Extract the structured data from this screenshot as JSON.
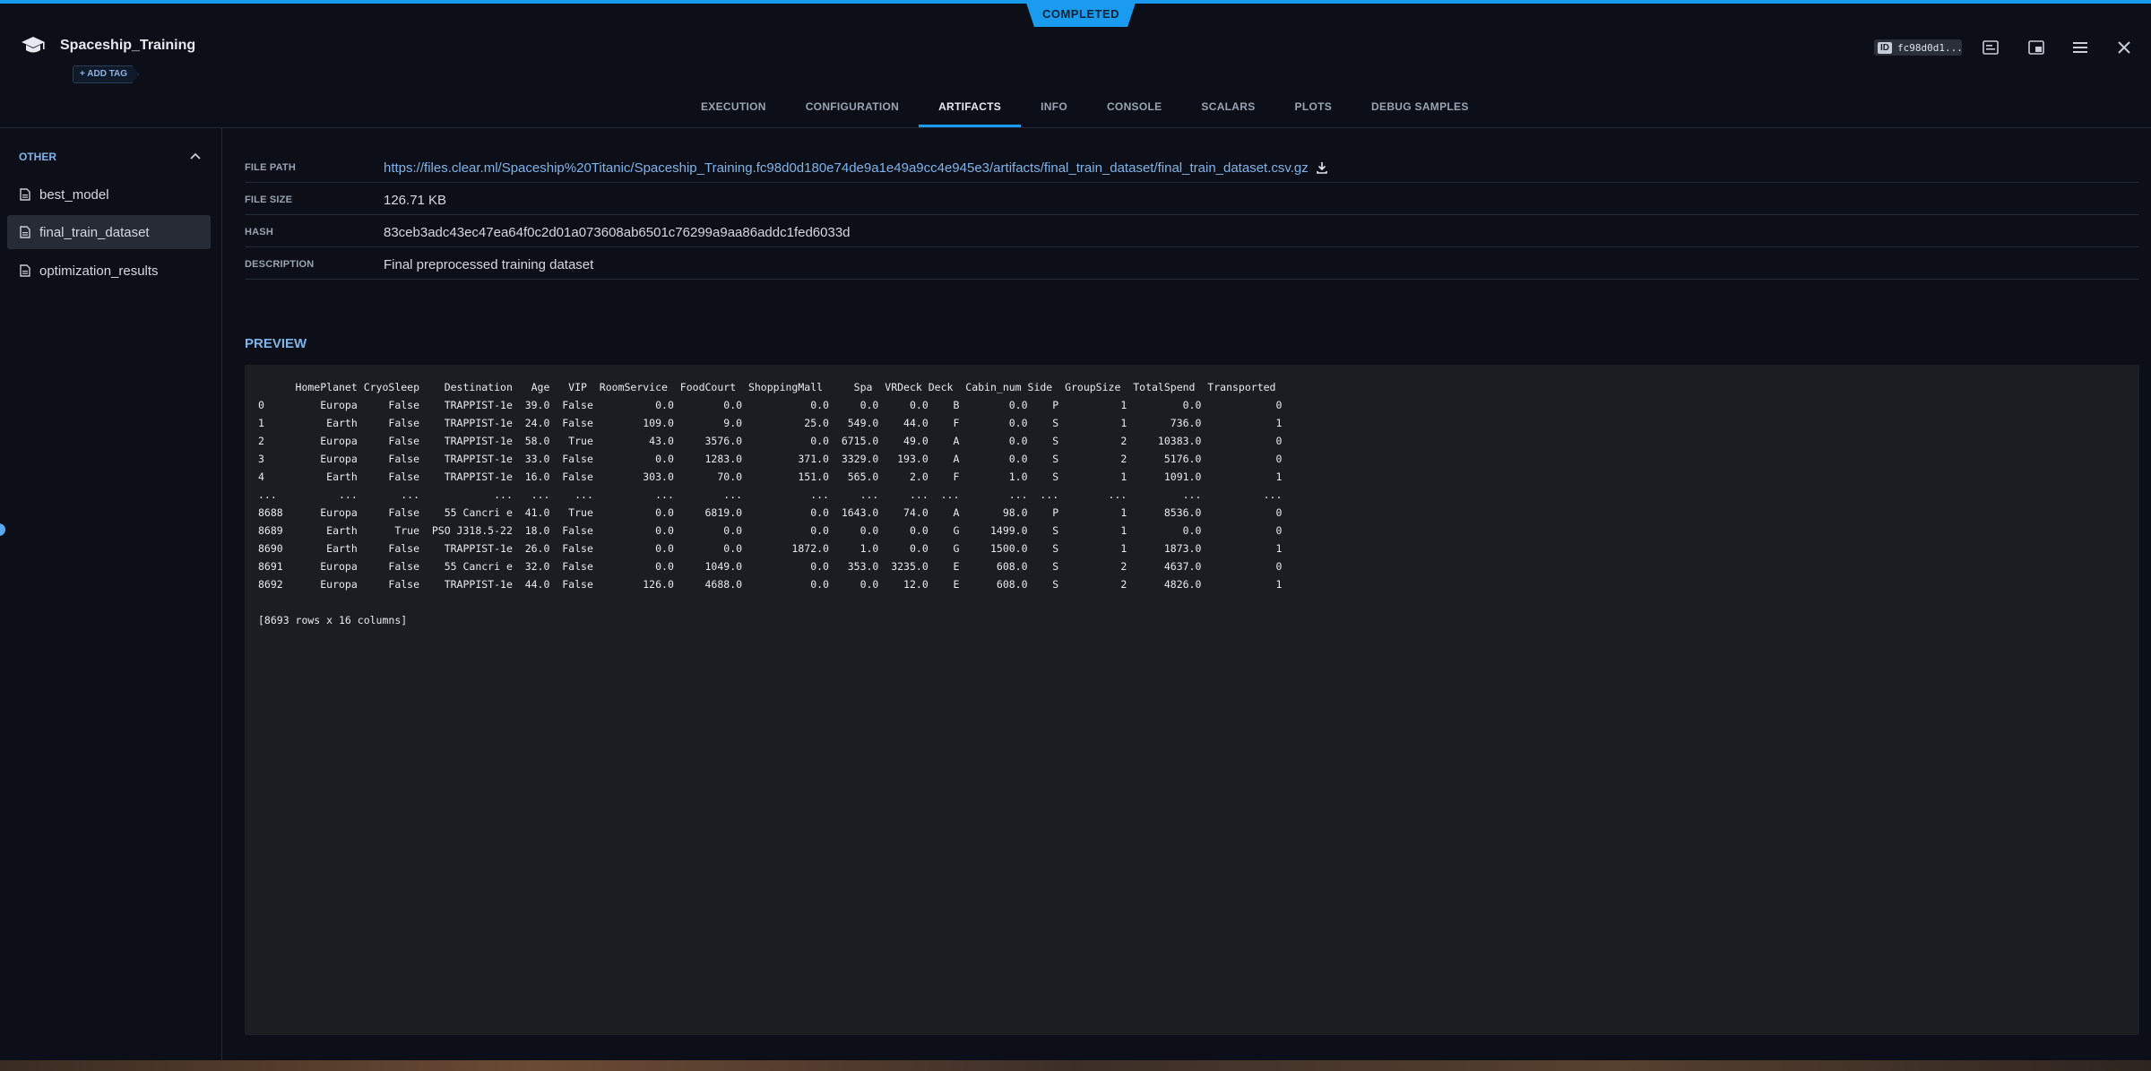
{
  "status": "COMPLETED",
  "task": {
    "title": "Spaceship_Training",
    "add_tag": "+ ADD TAG"
  },
  "id_chip": {
    "label": "ID",
    "value": "fc98d0d1..."
  },
  "tabs": [
    {
      "label": "EXECUTION"
    },
    {
      "label": "CONFIGURATION"
    },
    {
      "label": "ARTIFACTS"
    },
    {
      "label": "INFO"
    },
    {
      "label": "CONSOLE"
    },
    {
      "label": "SCALARS"
    },
    {
      "label": "PLOTS"
    },
    {
      "label": "DEBUG SAMPLES"
    }
  ],
  "sidebar": {
    "group": "OTHER",
    "items": [
      {
        "label": "best_model"
      },
      {
        "label": "final_train_dataset"
      },
      {
        "label": "optimization_results"
      }
    ]
  },
  "artifact": {
    "file_path_label": "FILE PATH",
    "file_path": "https://files.clear.ml/Spaceship%20Titanic/Spaceship_Training.fc98d0d180e74de9a1e49a9cc4e945e3/artifacts/final_train_dataset/final_train_dataset.csv.gz",
    "file_size_label": "FILE SIZE",
    "file_size": "126.71 KB",
    "hash_label": "HASH",
    "hash": "83ceb3adc43ec47ea64f0c2d01a073608ab6501c76299a9aa86addc1fed6033d",
    "description_label": "DESCRIPTION",
    "description": "Final preprocessed training dataset"
  },
  "preview": {
    "title": "PREVIEW",
    "text": "      HomePlanet CryoSleep    Destination   Age   VIP  RoomService  FoodCourt  ShoppingMall     Spa  VRDeck Deck  Cabin_num Side  GroupSize  TotalSpend  Transported\n0         Europa     False    TRAPPIST-1e  39.0  False          0.0        0.0           0.0     0.0     0.0    B        0.0    P          1         0.0            0\n1          Earth     False    TRAPPIST-1e  24.0  False        109.0        9.0          25.0   549.0    44.0    F        0.0    S          1       736.0            1\n2         Europa     False    TRAPPIST-1e  58.0   True         43.0     3576.0           0.0  6715.0    49.0    A        0.0    S          2     10383.0            0\n3         Europa     False    TRAPPIST-1e  33.0  False          0.0     1283.0         371.0  3329.0   193.0    A        0.0    S          2      5176.0            0\n4          Earth     False    TRAPPIST-1e  16.0  False        303.0       70.0         151.0   565.0     2.0    F        1.0    S          1      1091.0            1\n...          ...       ...            ...   ...    ...          ...        ...           ...     ...     ...  ...        ...  ...        ...         ...          ...\n8688      Europa     False    55 Cancri e  41.0   True          0.0     6819.0           0.0  1643.0    74.0    A       98.0    P          1      8536.0            0\n8689       Earth      True  PSO J318.5-22  18.0  False          0.0        0.0           0.0     0.0     0.0    G     1499.0    S          1         0.0            0\n8690       Earth     False    TRAPPIST-1e  26.0  False          0.0        0.0        1872.0     1.0     0.0    G     1500.0    S          1      1873.0            1\n8691      Europa     False    55 Cancri e  32.0  False          0.0     1049.0           0.0   353.0  3235.0    E      608.0    S          2      4637.0            0\n8692      Europa     False    TRAPPIST-1e  44.0  False        126.0     4688.0           0.0     0.0    12.0    E      608.0    S          2      4826.0            1\n\n[8693 rows x 16 columns]"
  },
  "colors": {
    "accent": "#1a9bef",
    "background": "#0c0f17",
    "panel": "#1b1d22",
    "link": "#7fb3ea"
  },
  "icons": [
    "graduation-cap-icon",
    "download-icon",
    "file-icon",
    "chevron-up-icon",
    "details-icon",
    "panel-icon",
    "menu-icon",
    "close-icon"
  ]
}
